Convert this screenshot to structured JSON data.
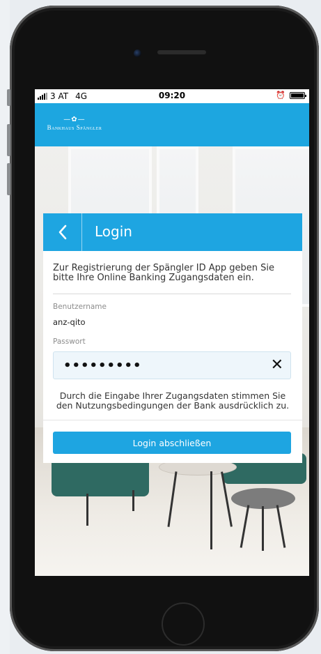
{
  "status_bar": {
    "carrier": "3 AT",
    "network": "4G",
    "time": "09:20"
  },
  "header": {
    "logo_mark": "—✿—",
    "logo_text": "Bankhaus Spängler"
  },
  "login": {
    "title": "Login",
    "intro": "Zur Registrierung der Spängler ID App geben Sie bitte Ihre Online Banking Zugangsdaten ein.",
    "username_label": "Benutzername",
    "username_value": "anz-qito",
    "password_label": "Passwort",
    "password_value": "•••••••••",
    "terms_text": "Durch die Eingabe Ihrer Zugangsdaten stimmen Sie den Nutzungsbedingungen der Bank ausdrücklich zu.",
    "submit_label": "Login abschließen"
  },
  "icons": [
    "back-chevron-icon",
    "clear-icon",
    "signal-icon",
    "alarm-icon",
    "battery-icon"
  ],
  "colors": {
    "accent": "#1da6e0"
  }
}
